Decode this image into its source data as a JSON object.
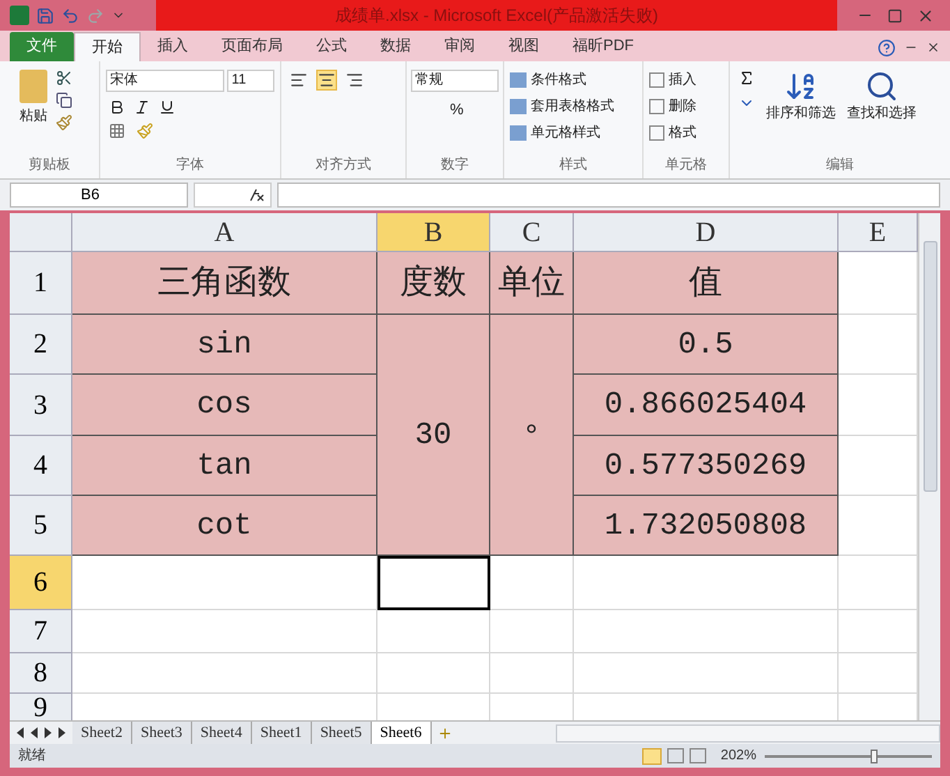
{
  "window": {
    "title": "成绩单.xlsx - Microsoft Excel(产品激活失败)"
  },
  "ribbon_tabs": [
    {
      "label": "文件",
      "kind": "file",
      "selected": false
    },
    {
      "label": "开始",
      "kind": "tab",
      "selected": true
    },
    {
      "label": "插入",
      "kind": "tab",
      "selected": false
    },
    {
      "label": "页面布局",
      "kind": "tab",
      "selected": false
    },
    {
      "label": "公式",
      "kind": "tab",
      "selected": false
    },
    {
      "label": "数据",
      "kind": "tab",
      "selected": false
    },
    {
      "label": "审阅",
      "kind": "tab",
      "selected": false
    },
    {
      "label": "视图",
      "kind": "tab",
      "selected": false
    },
    {
      "label": "福昕PDF",
      "kind": "tab",
      "selected": false
    }
  ],
  "ribbon": {
    "paste": "粘贴",
    "font_name": "宋体",
    "font_size": "11",
    "number_format": "常规",
    "percent": "%",
    "styles": [
      "条件格式",
      "套用表格格式",
      "单元格样式"
    ],
    "cells": [
      "插入",
      "删除",
      "格式"
    ],
    "sort_filter": "排序和筛选",
    "find_select": "查找和选择",
    "groups": [
      "剪贴板",
      "字体",
      "对齐方式",
      "数字",
      "样式",
      "单元格",
      "编辑"
    ]
  },
  "formula_bar": {
    "name_box": "B6"
  },
  "columns": [
    {
      "label": "A",
      "selected": false
    },
    {
      "label": "B",
      "selected": true
    },
    {
      "label": "C",
      "selected": false
    },
    {
      "label": "D",
      "selected": false
    },
    {
      "label": "E",
      "selected": false
    }
  ],
  "row_headers": [
    {
      "label": "1",
      "selected": false
    },
    {
      "label": "2",
      "selected": false
    },
    {
      "label": "3",
      "selected": false
    },
    {
      "label": "4",
      "selected": false
    },
    {
      "label": "5",
      "selected": false
    },
    {
      "label": "6",
      "selected": true
    },
    {
      "label": "7",
      "selected": false
    },
    {
      "label": "8",
      "selected": false
    },
    {
      "label": "9",
      "selected": false
    }
  ],
  "table": {
    "header": [
      "三角函数",
      "度数",
      "单位",
      "值"
    ],
    "rows": [
      {
        "function": "sin",
        "value": "0.5"
      },
      {
        "function": "cos",
        "value": "0.866025404"
      },
      {
        "function": "tan",
        "value": "0.577350269"
      },
      {
        "function": "cot",
        "value": "1.732050808"
      }
    ],
    "degrees": "30",
    "unit": "°"
  },
  "sheets": [
    {
      "label": "Sheet2",
      "selected": false
    },
    {
      "label": "Sheet3",
      "selected": false
    },
    {
      "label": "Sheet4",
      "selected": false
    },
    {
      "label": "Sheet1",
      "selected": false
    },
    {
      "label": "Sheet5",
      "selected": false
    },
    {
      "label": "Sheet6",
      "selected": true
    }
  ],
  "status_bar": {
    "status": "就绪",
    "zoom": "202%",
    "zoom_slider": {
      "level": 0.65
    }
  }
}
